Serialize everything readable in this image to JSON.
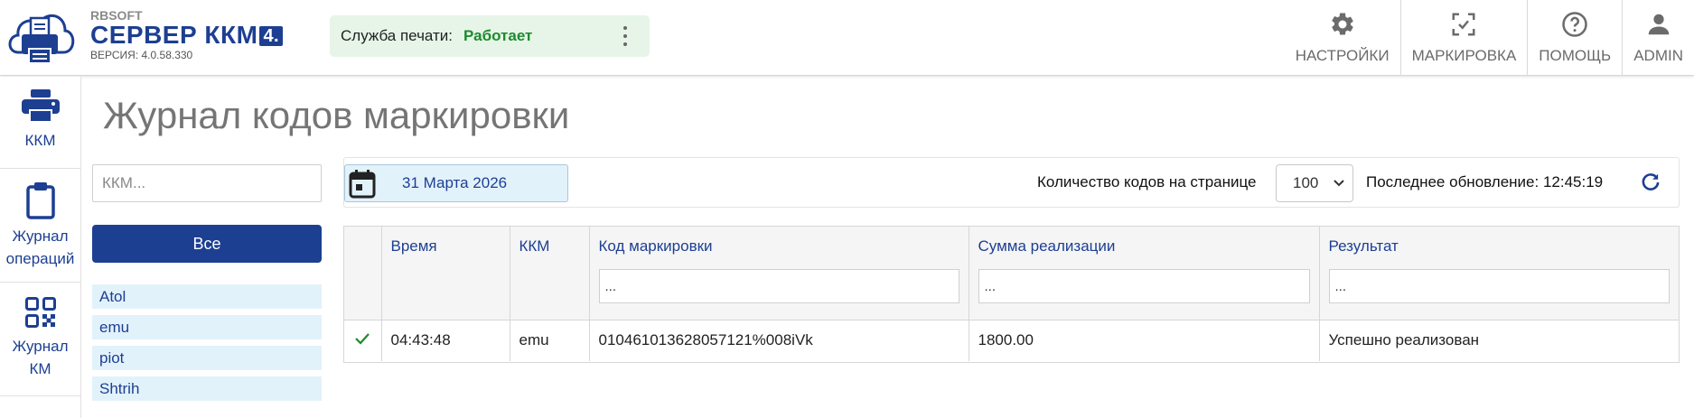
{
  "header": {
    "brand": "RBSOFT",
    "product": "СЕРВЕР ККМ",
    "product_badge": "4.",
    "version": "ВЕРСИЯ: 4.0.58.330",
    "print_service_label": "Служба печати:",
    "print_service_status": "Работает",
    "nav": [
      {
        "label": "НАСТРОЙКИ",
        "icon": "gear-icon"
      },
      {
        "label": "МАРКИРОВКА",
        "icon": "scan-icon"
      },
      {
        "label": "ПОМОЩЬ",
        "icon": "help-icon"
      },
      {
        "label": "ADMIN",
        "icon": "user-icon"
      }
    ]
  },
  "sidebar": {
    "items": [
      {
        "label": "ККМ",
        "icon": "printer-icon"
      },
      {
        "label": "Журнал операций",
        "icon": "clipboard-icon"
      },
      {
        "label": "Журнал КМ",
        "icon": "qr-code-icon"
      }
    ]
  },
  "page": {
    "title": "Журнал кодов маркировки"
  },
  "filters": {
    "kkm_search_placeholder": "ККМ...",
    "all_button": "Все",
    "kkm_list": [
      "Atol",
      "emu",
      "piot",
      "Shtrih"
    ],
    "date": "31 Марта 2026",
    "per_page_label": "Количество кодов на странице",
    "per_page_value": "100",
    "last_update": "Последнее обновление: 12:45:19"
  },
  "table": {
    "columns": [
      "Время",
      "ККМ",
      "Код маркировки",
      "Сумма реализации",
      "Результат"
    ],
    "filter_placeholder": "...",
    "rows": [
      {
        "status": "success",
        "time": "04:43:48",
        "kkm": "emu",
        "code": "010461013628057121%008iVk",
        "sum": "1800.00",
        "result": "Успешно реализован"
      }
    ]
  },
  "colors": {
    "accent": "#1d3f92",
    "status_ok": "#1e8a2e",
    "light_blue": "#e2f2fb",
    "light_green": "#e6f5e8"
  }
}
